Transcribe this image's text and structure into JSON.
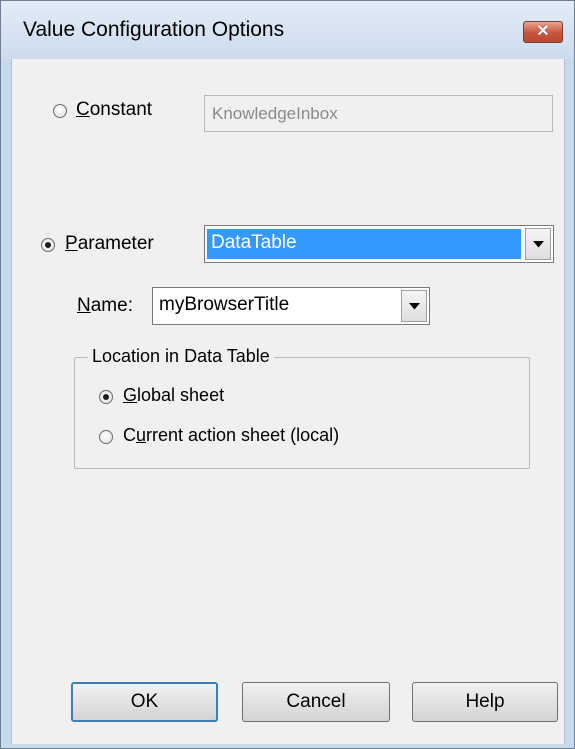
{
  "window": {
    "title": "Value Configuration Options",
    "close_glyph": "✕"
  },
  "constant": {
    "label": "Constant",
    "mnemonic": "C",
    "rest": "onstant",
    "selected": false,
    "value": "KnowledgeInbox"
  },
  "parameter": {
    "label": "Parameter",
    "mnemonic": "P",
    "rest": "arameter",
    "selected": true,
    "value": "DataTable"
  },
  "name_field": {
    "label": "Name:",
    "mnemonic": "N",
    "rest": "ame:",
    "value": "myBrowserTitle"
  },
  "location_group": {
    "caption": "Location in Data Table",
    "options": [
      {
        "label": "Global sheet",
        "mnemonic": "G",
        "rest": "lobal sheet",
        "selected": true
      },
      {
        "label": "Current action sheet (local)",
        "pre": "C",
        "mnemonic": "u",
        "rest": "rrent action sheet (local)",
        "selected": false
      }
    ]
  },
  "buttons": {
    "ok": "OK",
    "cancel": "Cancel",
    "help": "Help"
  },
  "icons": {
    "close": "close-icon",
    "dropdown": "chevron-down-icon"
  },
  "colors": {
    "selection": "#3399ff",
    "close_button": "#c8553f",
    "titlebar": "#d5e2f2"
  }
}
